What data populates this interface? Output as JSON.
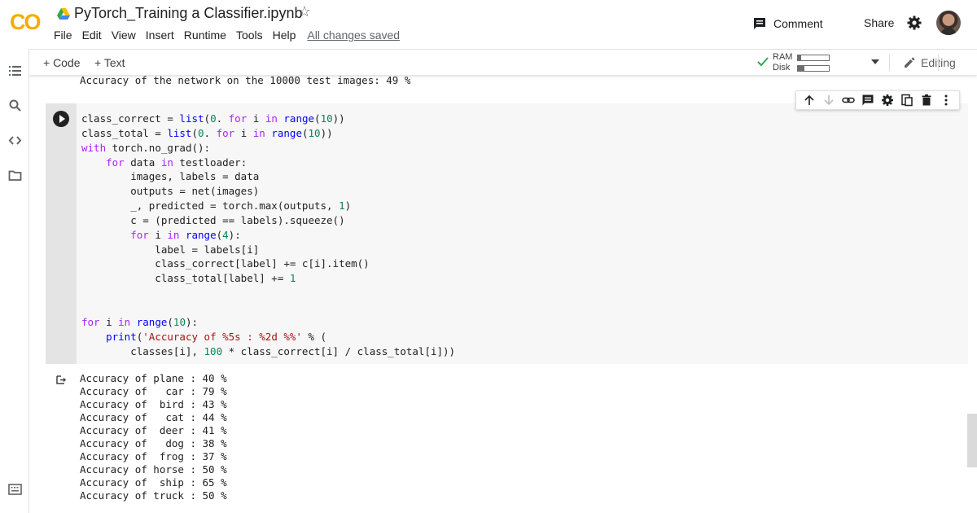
{
  "header": {
    "logo": "CO",
    "title": "PyTorch_Training a Classifier.ipynb",
    "menu": [
      "File",
      "Edit",
      "View",
      "Insert",
      "Runtime",
      "Tools",
      "Help"
    ],
    "save_status": "All changes saved",
    "comment_label": "Comment",
    "share_label": "Share"
  },
  "toolbar": {
    "add_code": "+ Code",
    "add_text": "+ Text",
    "ram_label": "RAM",
    "disk_label": "Disk",
    "ram_usage": 0.1,
    "disk_usage": 0.2,
    "editing_label": "Editing"
  },
  "prev_output": "Accuracy of the network on the 10000 test images: 49 %",
  "code_cell": {
    "lines": [
      "class_correct = list(0. for i in range(10))",
      "class_total = list(0. for i in range(10))",
      "with torch.no_grad():",
      "    for data in testloader:",
      "        images, labels = data",
      "        outputs = net(images)",
      "        _, predicted = torch.max(outputs, 1)",
      "        c = (predicted == labels).squeeze()",
      "        for i in range(4):",
      "            label = labels[i]",
      "            class_correct[label] += c[i].item()",
      "            class_total[label] += 1",
      "",
      "",
      "for i in range(10):",
      "    print('Accuracy of %5s : %2d %%' % (",
      "        classes[i], 100 * class_correct[i] / class_total[i]))"
    ]
  },
  "output_lines": [
    "Accuracy of plane : 40 %",
    "Accuracy of   car : 79 %",
    "Accuracy of  bird : 43 %",
    "Accuracy of   cat : 44 %",
    "Accuracy of  deer : 41 %",
    "Accuracy of   dog : 38 %",
    "Accuracy of  frog : 37 %",
    "Accuracy of horse : 50 %",
    "Accuracy of  ship : 65 %",
    "Accuracy of truck : 50 %"
  ],
  "colors": {
    "logo_yellow": "#f9ab00",
    "logo_orange": "#e8710a",
    "check_green": "#34a853",
    "keyword": "#aa22ff",
    "builtin": "#0000ff",
    "number": "#098658",
    "string": "#a31515"
  },
  "icons": {
    "left_rail": [
      "table-of-contents-icon",
      "search-icon",
      "code-snippets-icon",
      "files-icon",
      "terminal-icon"
    ],
    "cell_toolbar": [
      "move-up-icon",
      "move-down-icon",
      "link-icon",
      "comment-icon",
      "settings-icon",
      "mirror-cell-icon",
      "delete-icon",
      "more-icon"
    ]
  }
}
